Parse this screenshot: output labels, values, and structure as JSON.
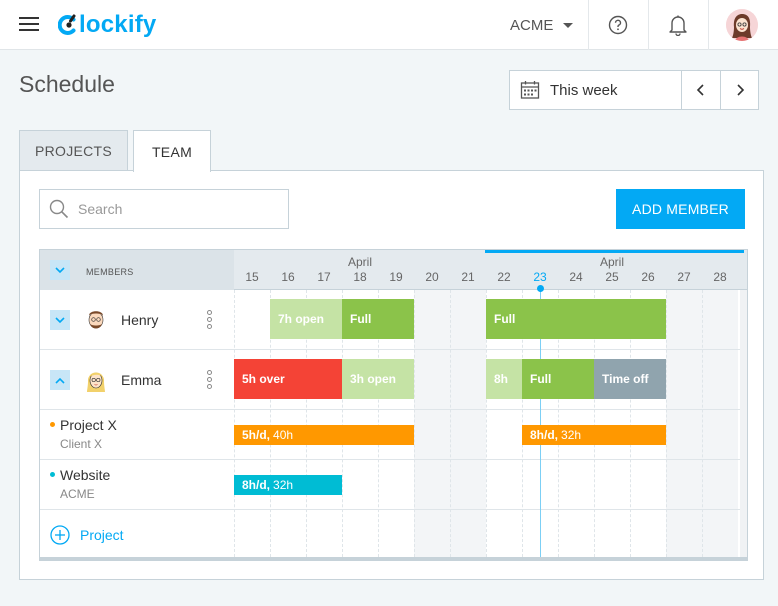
{
  "header": {
    "logo_text": "lockify",
    "workspace": "ACME"
  },
  "page": {
    "title": "Schedule"
  },
  "date_range": {
    "label": "This week"
  },
  "tabs": [
    {
      "label": "PROJECTS",
      "active": false
    },
    {
      "label": "TEAM",
      "active": true
    }
  ],
  "search": {
    "placeholder": "Search",
    "value": ""
  },
  "add_member_label": "ADD MEMBER",
  "grid": {
    "members_header": "MEMBERS",
    "months": [
      {
        "label": "April",
        "day": 18
      },
      {
        "label": "April",
        "day": 25
      }
    ],
    "days": [
      15,
      16,
      17,
      18,
      19,
      20,
      21,
      22,
      23,
      24,
      25,
      26,
      27,
      28
    ],
    "today": 23,
    "weekends": [
      20,
      27
    ]
  },
  "members": [
    {
      "name": "Henry",
      "expanded": false
    },
    {
      "name": "Emma",
      "expanded": true
    }
  ],
  "schedule_bars": {
    "henry": [
      {
        "label": "7h open",
        "start": 16,
        "end": 17,
        "color": "#c5e3a5"
      },
      {
        "label": "Full",
        "start": 18,
        "end": 19,
        "color": "#8bc34a"
      },
      {
        "label": "Full",
        "start": 22,
        "end": 26,
        "color": "#8bc34a"
      }
    ],
    "emma": [
      {
        "label": "5h over",
        "start": 15,
        "end": 17,
        "color": "#f44336"
      },
      {
        "label": "3h open",
        "start": 18,
        "end": 19,
        "color": "#c5e3a5"
      },
      {
        "label": "8h",
        "start": 22,
        "end": 22,
        "color": "#c5e3a5"
      },
      {
        "label": "Full",
        "start": 23,
        "end": 24,
        "color": "#8bc34a"
      },
      {
        "label": "Time off",
        "start": 25,
        "end": 26,
        "color": "#90a4ae"
      }
    ]
  },
  "projects": [
    {
      "name": "Project X",
      "client": "Client X",
      "color": "#ff9800",
      "assignments": [
        {
          "rate": "5h/d,",
          "total": "40h",
          "start": 15,
          "end": 19
        },
        {
          "rate": "8h/d,",
          "total": "32h",
          "start": 23,
          "end": 26
        }
      ]
    },
    {
      "name": "Website",
      "client": "ACME",
      "color": "#00bcd4",
      "assignments": [
        {
          "rate": "8h/d,",
          "total": "32h",
          "start": 15,
          "end": 17
        }
      ]
    }
  ],
  "add_project_label": "Project"
}
